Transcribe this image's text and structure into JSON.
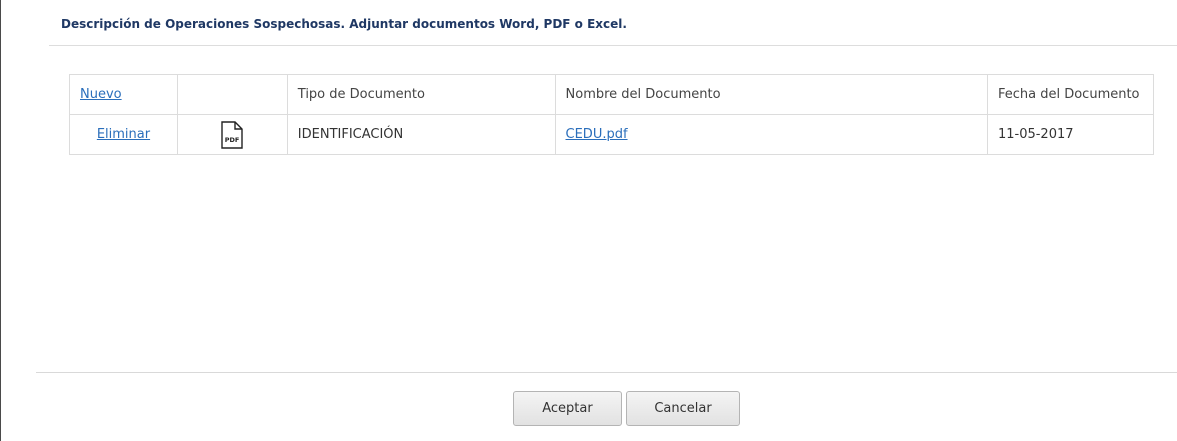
{
  "section": {
    "title": "Descripción de Operaciones Sospechosas. Adjuntar documentos Word, PDF o Excel."
  },
  "table": {
    "headers": {
      "nuevo": "Nuevo",
      "icon": "",
      "tipo": "Tipo de Documento",
      "nombre": "Nombre del Documento",
      "fecha": "Fecha del Documento"
    },
    "rows": [
      {
        "action": "Eliminar",
        "icon": "pdf-file-icon",
        "icon_text": "PDF",
        "tipo": "IDENTIFICACIÓN",
        "nombre": "CEDU.pdf",
        "fecha": "11-05-2017"
      }
    ]
  },
  "footer": {
    "accept_label": "Aceptar",
    "cancel_label": "Cancelar"
  },
  "colors": {
    "title": "#1f3864",
    "link": "#2a6ebb",
    "border": "#dcdcdc"
  }
}
